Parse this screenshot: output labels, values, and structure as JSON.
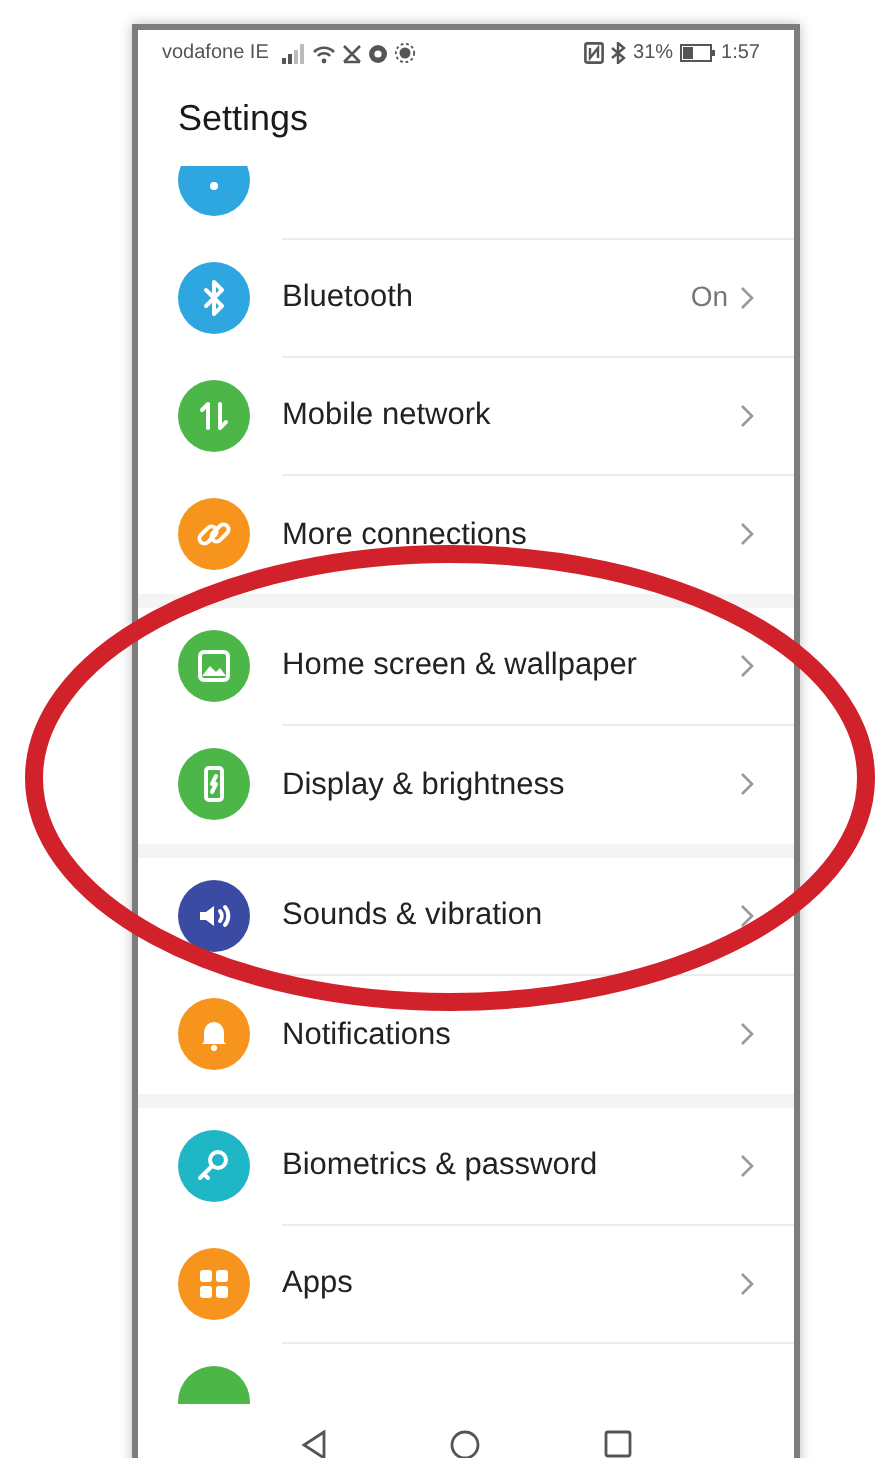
{
  "status_bar": {
    "carrier": "vodafone IE",
    "battery": "31%",
    "time": "1:57"
  },
  "title": "Settings",
  "groups": [
    {
      "items": [
        {
          "color": "#2ea6e0"
        },
        {
          "label": "Bluetooth",
          "value": "On",
          "color": "#2ea6e0"
        },
        {
          "label": "Mobile network",
          "color": "#4cb748"
        },
        {
          "label": "More connections",
          "color": "#f7941d"
        }
      ]
    },
    {
      "items": [
        {
          "label": "Home screen & wallpaper",
          "color": "#4cb748"
        },
        {
          "label": "Display & brightness",
          "color": "#4cb748"
        }
      ]
    },
    {
      "items": [
        {
          "label": "Sounds & vibration",
          "color": "#3b4ba3"
        },
        {
          "label": "Notifications",
          "color": "#f7941d"
        }
      ]
    },
    {
      "items": [
        {
          "label": "Biometrics & password",
          "color": "#1fb6c6"
        },
        {
          "label": "Apps",
          "color": "#f7941d"
        },
        {
          "color": "#4cb748"
        }
      ]
    }
  ]
}
